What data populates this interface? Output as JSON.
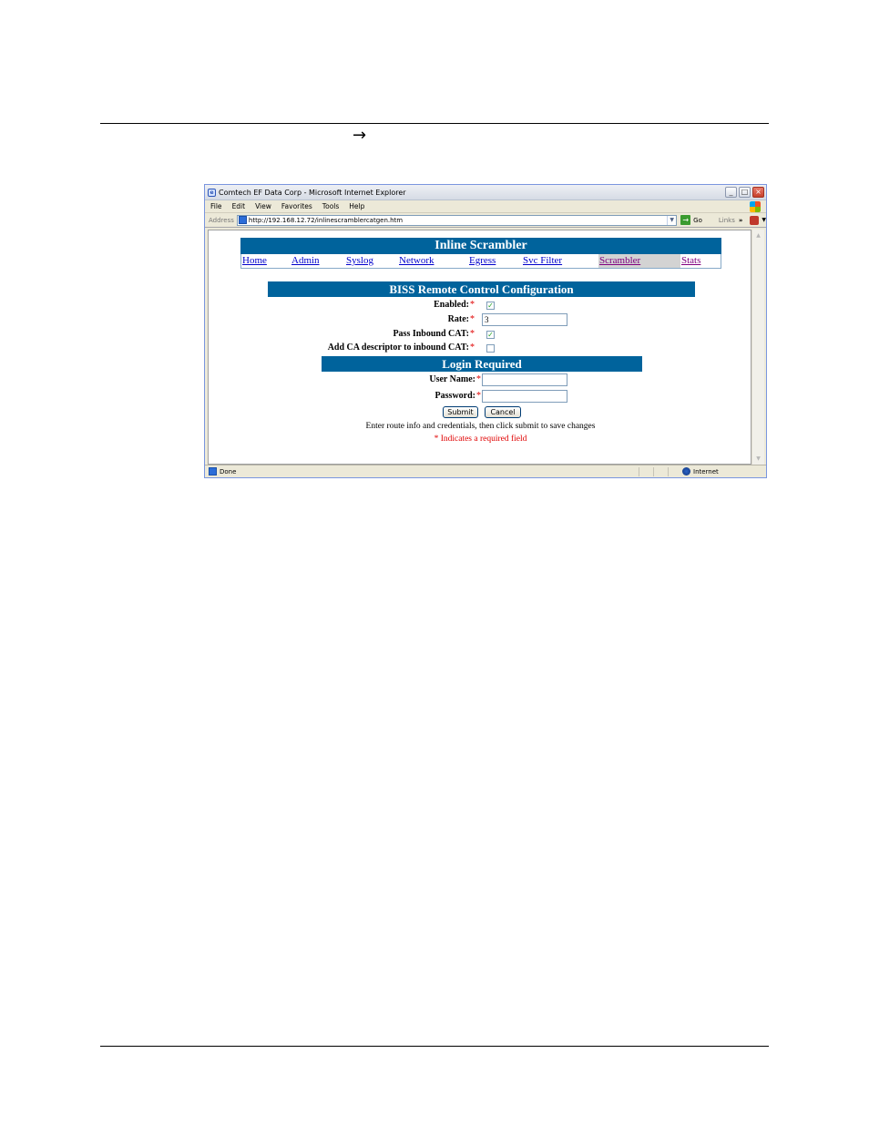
{
  "document": {
    "arrow_glyph": "→"
  },
  "browser": {
    "title": "Comtech EF Data Corp - Microsoft Internet Explorer",
    "controls": {
      "minimize": "_",
      "maximize": "□",
      "close": "×"
    },
    "menu": [
      "File",
      "Edit",
      "View",
      "Favorites",
      "Tools",
      "Help"
    ],
    "address_label": "Address",
    "address_url": "http://192.168.12.72/inlinescramblercatgen.htm",
    "go_label": "Go",
    "links_label": "Links",
    "links_chevron": "»",
    "status_text": "Done",
    "zone_text": "Internet"
  },
  "webpage": {
    "header": "Inline Scrambler",
    "nav": [
      "Home",
      "Admin",
      "Syslog",
      "Network",
      "Egress",
      "Svc Filter",
      "Scrambler",
      "Stats"
    ],
    "active_nav": "Scrambler",
    "biss_header": "BISS Remote Control Configuration",
    "fields": {
      "enabled_label": "Enabled:",
      "enabled_checked": true,
      "rate_label": "Rate:",
      "rate_value": "3",
      "pass_cat_label": "Pass Inbound CAT:",
      "pass_cat_checked": true,
      "add_ca_label": "Add CA descriptor to inbound CAT:",
      "add_ca_checked": false
    },
    "required_marker": "*",
    "login_header": "Login Required",
    "username_label": "User Name:",
    "password_label": "Password:",
    "submit_label": "Submit",
    "cancel_label": "Cancel",
    "instruction": "Enter route info and credentials, then click submit to save changes",
    "required_note": "* Indicates a required field"
  }
}
